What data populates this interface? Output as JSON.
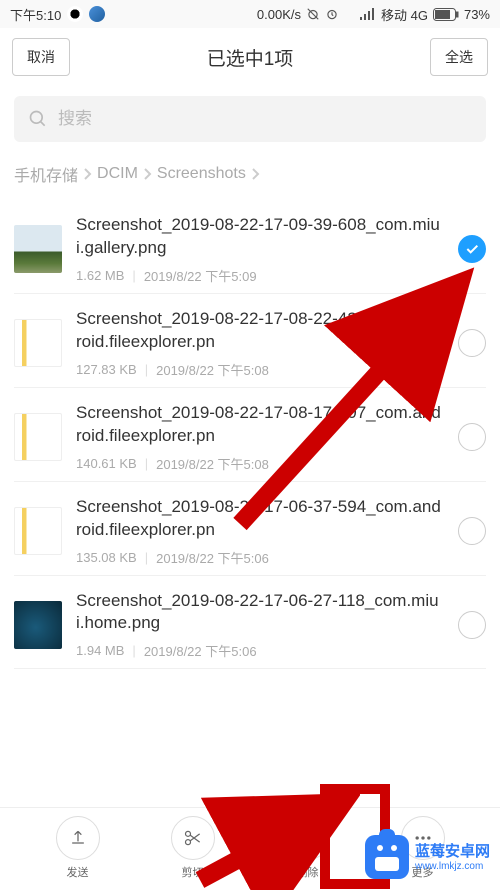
{
  "status": {
    "time": "下午5:10",
    "speed": "0.00K/s",
    "carrier": "移动 4G",
    "battery": "73%"
  },
  "header": {
    "cancel": "取消",
    "title": "已选中1项",
    "select_all": "全选"
  },
  "search": {
    "placeholder": "搜索"
  },
  "breadcrumb": [
    "手机存储",
    "DCIM",
    "Screenshots"
  ],
  "files": [
    {
      "name": "Screenshot_2019-08-22-17-09-39-608_com.miui.gallery.png",
      "size": "1.62 MB",
      "date": "2019/8/22 下午5:09",
      "selected": true,
      "thumb": "landscape"
    },
    {
      "name": "Screenshot_2019-08-22-17-08-22-421_com.android.fileexplorer.pn",
      "size": "127.83 KB",
      "date": "2019/8/22 下午5:08",
      "selected": false,
      "thumb": "file"
    },
    {
      "name": "Screenshot_2019-08-22-17-08-17-707_com.android.fileexplorer.pn",
      "size": "140.61 KB",
      "date": "2019/8/22 下午5:08",
      "selected": false,
      "thumb": "file"
    },
    {
      "name": "Screenshot_2019-08-22-17-06-37-594_com.android.fileexplorer.pn",
      "size": "135.08 KB",
      "date": "2019/8/22 下午5:06",
      "selected": false,
      "thumb": "file"
    },
    {
      "name": "Screenshot_2019-08-22-17-06-27-118_com.miui.home.png",
      "size": "1.94 MB",
      "date": "2019/8/22 下午5:06",
      "selected": false,
      "thumb": "dark"
    }
  ],
  "actions": {
    "send": "发送",
    "cut": "剪切",
    "delete": "删除",
    "more": "更多"
  },
  "watermark": {
    "title": "蓝莓安卓网",
    "url": "www.lmkjz.com"
  }
}
